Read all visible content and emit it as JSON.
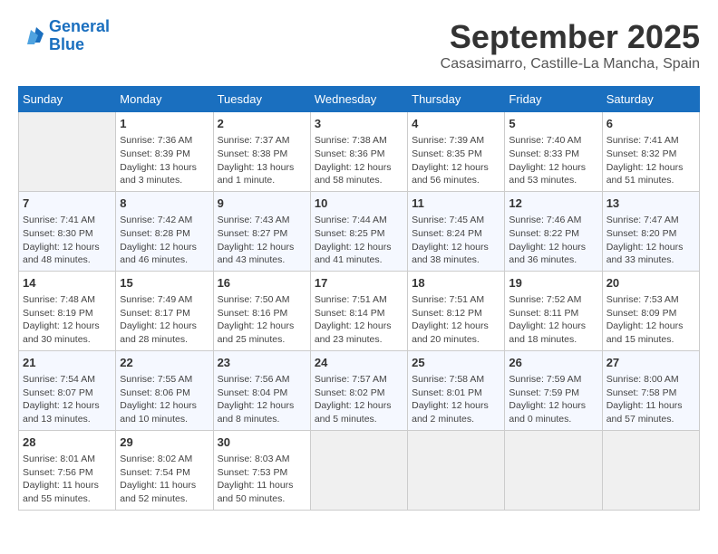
{
  "header": {
    "logo_line1": "General",
    "logo_line2": "Blue",
    "month": "September 2025",
    "location": "Casasimarro, Castille-La Mancha, Spain"
  },
  "weekdays": [
    "Sunday",
    "Monday",
    "Tuesday",
    "Wednesday",
    "Thursday",
    "Friday",
    "Saturday"
  ],
  "weeks": [
    [
      {
        "num": "",
        "empty": true
      },
      {
        "num": "1",
        "rise": "7:36 AM",
        "set": "8:39 PM",
        "daylight": "13 hours and 3 minutes."
      },
      {
        "num": "2",
        "rise": "7:37 AM",
        "set": "8:38 PM",
        "daylight": "13 hours and 1 minute."
      },
      {
        "num": "3",
        "rise": "7:38 AM",
        "set": "8:36 PM",
        "daylight": "12 hours and 58 minutes."
      },
      {
        "num": "4",
        "rise": "7:39 AM",
        "set": "8:35 PM",
        "daylight": "12 hours and 56 minutes."
      },
      {
        "num": "5",
        "rise": "7:40 AM",
        "set": "8:33 PM",
        "daylight": "12 hours and 53 minutes."
      },
      {
        "num": "6",
        "rise": "7:41 AM",
        "set": "8:32 PM",
        "daylight": "12 hours and 51 minutes."
      }
    ],
    [
      {
        "num": "7",
        "rise": "7:41 AM",
        "set": "8:30 PM",
        "daylight": "12 hours and 48 minutes."
      },
      {
        "num": "8",
        "rise": "7:42 AM",
        "set": "8:28 PM",
        "daylight": "12 hours and 46 minutes."
      },
      {
        "num": "9",
        "rise": "7:43 AM",
        "set": "8:27 PM",
        "daylight": "12 hours and 43 minutes."
      },
      {
        "num": "10",
        "rise": "7:44 AM",
        "set": "8:25 PM",
        "daylight": "12 hours and 41 minutes."
      },
      {
        "num": "11",
        "rise": "7:45 AM",
        "set": "8:24 PM",
        "daylight": "12 hours and 38 minutes."
      },
      {
        "num": "12",
        "rise": "7:46 AM",
        "set": "8:22 PM",
        "daylight": "12 hours and 36 minutes."
      },
      {
        "num": "13",
        "rise": "7:47 AM",
        "set": "8:20 PM",
        "daylight": "12 hours and 33 minutes."
      }
    ],
    [
      {
        "num": "14",
        "rise": "7:48 AM",
        "set": "8:19 PM",
        "daylight": "12 hours and 30 minutes."
      },
      {
        "num": "15",
        "rise": "7:49 AM",
        "set": "8:17 PM",
        "daylight": "12 hours and 28 minutes."
      },
      {
        "num": "16",
        "rise": "7:50 AM",
        "set": "8:16 PM",
        "daylight": "12 hours and 25 minutes."
      },
      {
        "num": "17",
        "rise": "7:51 AM",
        "set": "8:14 PM",
        "daylight": "12 hours and 23 minutes."
      },
      {
        "num": "18",
        "rise": "7:51 AM",
        "set": "8:12 PM",
        "daylight": "12 hours and 20 minutes."
      },
      {
        "num": "19",
        "rise": "7:52 AM",
        "set": "8:11 PM",
        "daylight": "12 hours and 18 minutes."
      },
      {
        "num": "20",
        "rise": "7:53 AM",
        "set": "8:09 PM",
        "daylight": "12 hours and 15 minutes."
      }
    ],
    [
      {
        "num": "21",
        "rise": "7:54 AM",
        "set": "8:07 PM",
        "daylight": "12 hours and 13 minutes."
      },
      {
        "num": "22",
        "rise": "7:55 AM",
        "set": "8:06 PM",
        "daylight": "12 hours and 10 minutes."
      },
      {
        "num": "23",
        "rise": "7:56 AM",
        "set": "8:04 PM",
        "daylight": "12 hours and 8 minutes."
      },
      {
        "num": "24",
        "rise": "7:57 AM",
        "set": "8:02 PM",
        "daylight": "12 hours and 5 minutes."
      },
      {
        "num": "25",
        "rise": "7:58 AM",
        "set": "8:01 PM",
        "daylight": "12 hours and 2 minutes."
      },
      {
        "num": "26",
        "rise": "7:59 AM",
        "set": "7:59 PM",
        "daylight": "12 hours and 0 minutes."
      },
      {
        "num": "27",
        "rise": "8:00 AM",
        "set": "7:58 PM",
        "daylight": "11 hours and 57 minutes."
      }
    ],
    [
      {
        "num": "28",
        "rise": "8:01 AM",
        "set": "7:56 PM",
        "daylight": "11 hours and 55 minutes."
      },
      {
        "num": "29",
        "rise": "8:02 AM",
        "set": "7:54 PM",
        "daylight": "11 hours and 52 minutes."
      },
      {
        "num": "30",
        "rise": "8:03 AM",
        "set": "7:53 PM",
        "daylight": "11 hours and 50 minutes."
      },
      {
        "num": "",
        "empty": true
      },
      {
        "num": "",
        "empty": true
      },
      {
        "num": "",
        "empty": true
      },
      {
        "num": "",
        "empty": true
      }
    ]
  ]
}
